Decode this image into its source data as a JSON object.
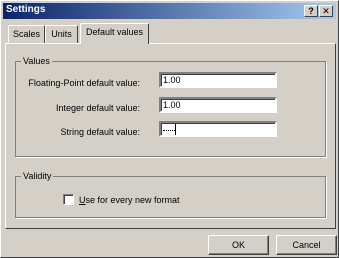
{
  "window": {
    "title": "Settings"
  },
  "titlebar_buttons": {
    "help": "?",
    "close": "✕"
  },
  "tabs": [
    {
      "label": "Scales",
      "active": false
    },
    {
      "label": "Units",
      "active": false
    },
    {
      "label": "Default values",
      "active": true
    }
  ],
  "values_group": {
    "legend": "Values",
    "fields": [
      {
        "label": "Floating-Point default value:",
        "value": "1.00"
      },
      {
        "label": "Integer default value:",
        "value": "1.00"
      },
      {
        "label": "String default value:",
        "value": ""
      }
    ]
  },
  "validity_group": {
    "legend": "Validity",
    "checkbox_label": "Use for every new format",
    "checked": false
  },
  "buttons": {
    "ok": "OK",
    "cancel": "Cancel"
  }
}
